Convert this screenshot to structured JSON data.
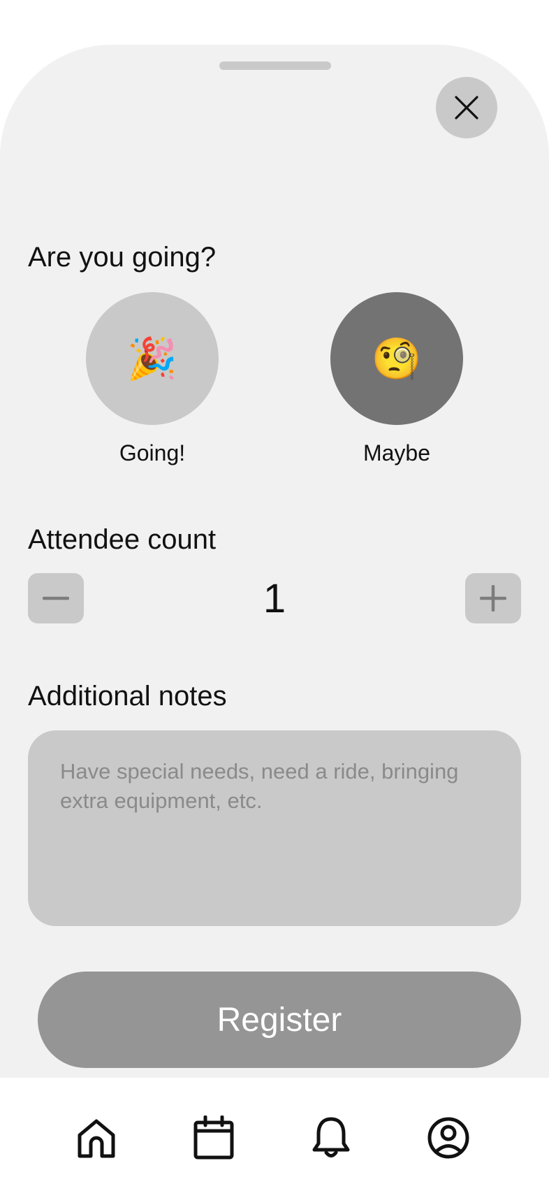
{
  "sheet": {
    "close_icon": "close-icon"
  },
  "rsvp": {
    "title": "Are you going?",
    "options": [
      {
        "label": "Going!",
        "emoji": "🎉",
        "icon": "party-popper-icon",
        "selected": false
      },
      {
        "label": "Maybe",
        "emoji": "🧐",
        "icon": "face-with-monocle-icon",
        "selected": true
      }
    ]
  },
  "attendees": {
    "title": "Attendee count",
    "value": "1",
    "decrement_icon": "minus-icon",
    "increment_icon": "plus-icon"
  },
  "notes": {
    "title": "Additional notes",
    "value": "",
    "placeholder": "Have special needs, need a ride, bringing extra equipment, etc."
  },
  "register": {
    "label": "Register"
  },
  "tabbar": {
    "items": [
      {
        "icon": "home-icon"
      },
      {
        "icon": "calendar-icon"
      },
      {
        "icon": "bell-icon"
      },
      {
        "icon": "user-circle-icon"
      }
    ]
  },
  "colors": {
    "sheet_bg": "#f1f1f1",
    "control_bg": "#c9c9c9",
    "selected_bg": "#737373",
    "register_bg": "#959595",
    "text": "#111111",
    "placeholder": "#8a8a8a"
  }
}
